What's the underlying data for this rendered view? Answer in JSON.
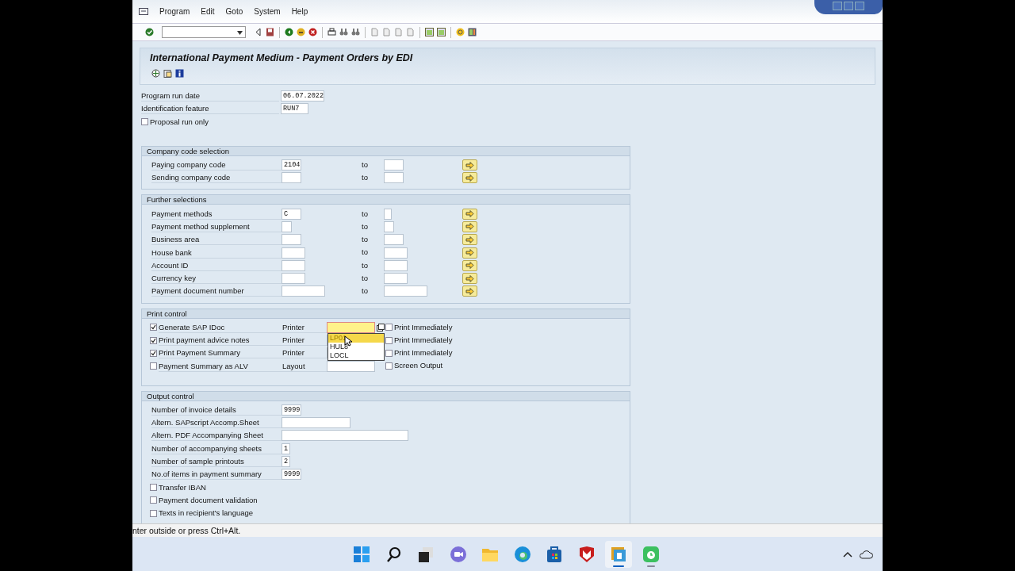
{
  "menu": [
    {
      "label": "Program"
    },
    {
      "label": "Edit"
    },
    {
      "label": "Goto"
    },
    {
      "label": "System"
    },
    {
      "label": "Help"
    }
  ],
  "title": "International Payment Medium - Payment Orders by EDI",
  "header_fields": [
    {
      "label": "Program run date",
      "value": "06.07.2022"
    },
    {
      "label": "Identification feature",
      "value": "RUN7"
    }
  ],
  "proposal": {
    "label": "Proposal run only",
    "checked": false
  },
  "sections": [
    {
      "title": "Company code selection",
      "rows": [
        {
          "label": "Paying company code",
          "from": "2104",
          "to_label": "to",
          "to": ""
        },
        {
          "label": "Sending company code",
          "from": "",
          "to_label": "to",
          "to": ""
        }
      ]
    },
    {
      "title": "Further selections",
      "rows": [
        {
          "label": "Payment methods",
          "from": "C",
          "to_label": "to",
          "to": ""
        },
        {
          "label": "Payment method supplement",
          "from": "",
          "to_label": "to",
          "to": ""
        },
        {
          "label": "Business area",
          "from": "",
          "to_label": "to",
          "to": ""
        },
        {
          "label": "House bank",
          "from": "",
          "to_label": "to",
          "to": ""
        },
        {
          "label": "Account ID",
          "from": "",
          "to_label": "to",
          "to": ""
        },
        {
          "label": "Currency key",
          "from": "",
          "to_label": "to",
          "to": ""
        },
        {
          "label": "Payment document number",
          "from": "",
          "to_label": "to",
          "to": ""
        }
      ]
    }
  ],
  "print_control": {
    "title": "Print control",
    "rows": [
      {
        "label": "Generate SAP IDoc",
        "checked": true,
        "device_label": "Printer",
        "value": "",
        "focused": true,
        "option_label": "Print Immediately",
        "option_checked": false
      },
      {
        "label": "Print payment advice notes",
        "checked": true,
        "device_label": "Printer",
        "value": "",
        "focused": false,
        "option_label": "Print Immediately",
        "option_checked": false
      },
      {
        "label": "Print Payment Summary",
        "checked": true,
        "device_label": "Printer",
        "value": "",
        "focused": false,
        "option_label": "Print Immediately",
        "option_checked": false
      },
      {
        "label": "Payment Summary as ALV",
        "checked": false,
        "device_label": "Layout",
        "value": "",
        "focused": false,
        "option_label": "Screen Output",
        "option_checked": false
      }
    ],
    "dropdown": [
      {
        "label": "LP01",
        "selected": true
      },
      {
        "label": "HUL8",
        "selected": false
      },
      {
        "label": "LOCL",
        "selected": false
      }
    ]
  },
  "output_control": {
    "title": "Output control",
    "rows": [
      {
        "kind": "field",
        "label": "Number of invoice details",
        "value": "9999"
      },
      {
        "kind": "field",
        "label": "Altern. SAPscript Accomp.Sheet",
        "value": ""
      },
      {
        "kind": "field",
        "label": "Altern. PDF Accompanying Sheet",
        "value": ""
      },
      {
        "kind": "field",
        "label": "Number of accompanying sheets",
        "value": "1"
      },
      {
        "kind": "field",
        "label": "Number of sample printouts",
        "value": "2"
      },
      {
        "kind": "field",
        "label": "No.of items in payment summary",
        "value": "9999"
      },
      {
        "kind": "checkbox",
        "label": "Transfer IBAN",
        "checked": false
      },
      {
        "kind": "checkbox",
        "label": "Payment document validation",
        "checked": false
      },
      {
        "kind": "checkbox",
        "label": "Texts in recipient's language",
        "checked": false
      }
    ]
  },
  "status_bar": "nter outside or press Ctrl+Alt.",
  "taskbar": [
    {
      "kind": "start",
      "active": false
    },
    {
      "kind": "search",
      "active": false
    },
    {
      "kind": "taskview",
      "active": false
    },
    {
      "kind": "chat",
      "active": false
    },
    {
      "kind": "folder",
      "active": false
    },
    {
      "kind": "browser",
      "active": false
    },
    {
      "kind": "store",
      "active": false
    },
    {
      "kind": "shield",
      "active": false
    },
    {
      "kind": "sap",
      "active": true
    },
    {
      "kind": "clock",
      "active": false
    }
  ]
}
